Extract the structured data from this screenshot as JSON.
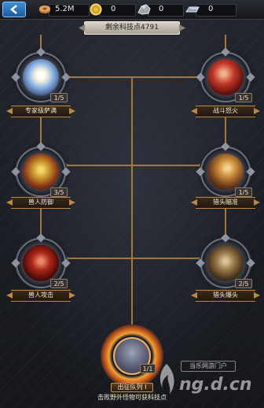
{
  "topbar": {
    "resources": [
      {
        "icon": "wood-log-icon",
        "value": "5.2M"
      },
      {
        "icon": "gold-coin-icon",
        "value": "0"
      },
      {
        "icon": "silver-ore-icon",
        "value": "0"
      },
      {
        "icon": "iron-ingot-icon",
        "value": "0"
      }
    ]
  },
  "banner": {
    "text": "剩余科技点4791"
  },
  "nodes": [
    {
      "name": "expert-shaman",
      "label": "专家级萨满",
      "level": "1/5",
      "icon": "light-orb-icon"
    },
    {
      "name": "battle-fury",
      "label": "战斗怒火",
      "level": "1/5",
      "icon": "warrior-rage-icon"
    },
    {
      "name": "orc-defense",
      "label": "兽人防御",
      "level": "3/5",
      "icon": "orc-shield-icon"
    },
    {
      "name": "headhunter-aim",
      "label": "猎头瞄准",
      "level": "1/5",
      "icon": "catapult-aim-icon"
    },
    {
      "name": "orc-attack",
      "label": "兽人攻击",
      "level": "2/5",
      "icon": "orc-axe-icon"
    },
    {
      "name": "headhunter-burst",
      "label": "猎头爆头",
      "level": "2/5",
      "icon": "catapult-burst-icon"
    }
  ],
  "special": {
    "label": "出征队列 I",
    "level": "1/1",
    "icon": "army-queue-icon"
  },
  "hint": "击败野外怪物可获科技点",
  "watermark": {
    "box_text": "当乐网游门户",
    "text": "ng.d.cn"
  },
  "colors": {
    "line": "#b3803f",
    "accent": "#c79550",
    "back_button": "#2f7fc9"
  }
}
